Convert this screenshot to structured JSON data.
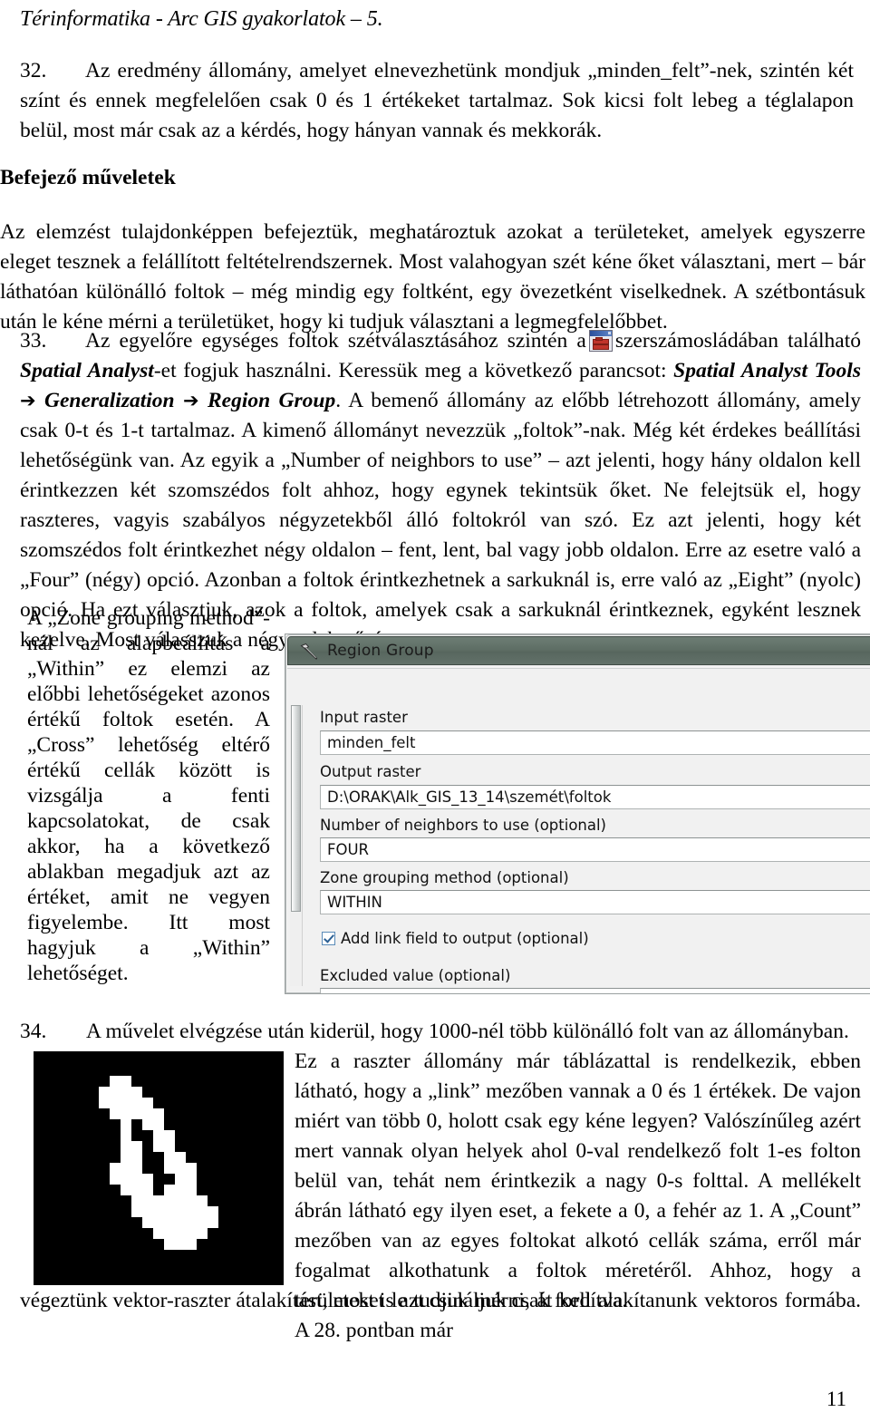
{
  "header": {
    "running_title": "Térinformatika - Arc GIS gyakorlatok – 5."
  },
  "paragraphs": {
    "p32_number": "32.",
    "p32_text": "Az eredmény állomány, amelyet elnevezhetünk mondjuk „minden_felt”-nek, szintén két színt és ennek megfelelően csak 0 és 1 értékeket tartalmaz. Sok kicsi folt lebeg a téglalapon belül, most már csak az a kérdés, hogy hányan vannak és mekkorák.",
    "section_heading": "Befejező műveletek",
    "intro_text": "Az elemzést tulajdonképpen befejeztük, meghatároztuk azokat a területeket, amelyek egyszerre eleget tesznek a felállított feltételrendszernek. Most valahogyan szét kéne őket választani, mert – bár láthatóan különálló foltok – még mindig egy foltként, egy övezetként viselkednek. A szétbontásuk után le kéne mérni a területüket, hogy ki tudjuk választani a legmegfelelőbbet.",
    "p33_number": "33.",
    "p33_part1": "Az egyelőre egységes foltok szétválasztásához szintén a",
    "p33_part2": "szerszámosládában található",
    "p33_spatial_analyst": "Spatial Analyst",
    "p33_part3": "-et fogjuk használni. Keressük meg a következő parancsot:",
    "p33_cmd1": "Spatial Analyst Tools",
    "p33_cmd2": "Generalization",
    "p33_cmd3": "Region Group",
    "p33_arrow": "➔",
    "p33_part4": ". A bemenő állomány az előbb létrehozott állomány, amely csak 0-t és 1-t tartalmaz. A kimenő állományt nevezzük „foltok”-nak. Még két érdekes beállítási lehetőségünk van. Az egyik a „Number of neighbors to use” – azt jelenti, hogy hány oldalon kell érintkezzen két szomszédos folt ahhoz, hogy egynek tekintsük őket. Ne felejtsük el, hogy raszteres, vagyis szabályos négyzetekből álló foltokról van szó. Ez azt jelenti, hogy két szomszédos folt érintkezhet négy oldalon – fent, lent, bal vagy jobb oldalon. Erre az esetre való a „Four” (négy) opció. Azonban a foltok érintkezhetnek a sarkuknál is, erre való az „Eight” (nyolc) opció. Ha ezt választjuk, azok a foltok, amelyek csak a sarkuknál érintkeznek, egyként lesznek kezelve. Most válasszuk a négyes lehetőséget.",
    "left_column_text": "A „Zone grouping method”-nál az alapbeállítás a „Within” ez elemzi az előbbi lehetőségeket azonos értékű foltok esetén. A „Cross” lehetőség eltérő értékű cellák között is vizsgálja a fenti kapcsolatokat, de csak akkor, ha a következő ablakban megadjuk azt az értéket, amit ne vegyen figyelembe. Itt most hagyjuk a „Within” lehetőséget.",
    "p34_number": "34.",
    "p34_line1": "A művelet elvégzése után kiderül, hogy 1000-nél több különálló folt van az állományban.",
    "p34_wrapped": "Ez a raszter állomány már táblázattal is rendelkezik, ebben látható, hogy a „link” mezőben vannak a 0 és 1 értékek. De vajon miért van több 0, holott csak egy kéne legyen? Valószínűleg azért mert vannak olyan helyek ahol 0-val rendelkező folt 1-es folton belül van, tehát nem érintkezik a nagy 0-s folttal. A mellékelt ábrán látható egy ilyen eset, a fekete a 0, a fehér az 1. A „Count” mezőben van az egyes foltokat alkotó cellák száma, erről már fogalmat alkothatunk a foltok méretéről. Ahhoz, hogy a területeket le tudjuk mérni, át kell alakítanunk vektoros formába. A 28. pontban már",
    "p34_tail": "végeztünk vektor-raszter átalakítást, most is azt csináljuk csak fordítva."
  },
  "dialog": {
    "title": "Region Group",
    "title_icon": "hammer-icon",
    "fields": [
      {
        "label": "Input raster",
        "value": "minden_felt"
      },
      {
        "label": "Output raster",
        "value": "D:\\ORAK\\Alk_GIS_13_14\\szemét\\foltok"
      },
      {
        "label": "Number of neighbors to use (optional)",
        "value": "FOUR"
      },
      {
        "label": "Zone grouping method (optional)",
        "value": "WITHIN"
      },
      {
        "label": "Excluded value (optional)",
        "value": ""
      }
    ],
    "checkbox": {
      "label": "Add link field to output (optional)",
      "checked": true
    }
  },
  "figure": {
    "caption_alt": "raster-patch-figure",
    "background_color": "#000000",
    "foreground_color": "#ffffff"
  },
  "footer": {
    "page_number": "11"
  }
}
